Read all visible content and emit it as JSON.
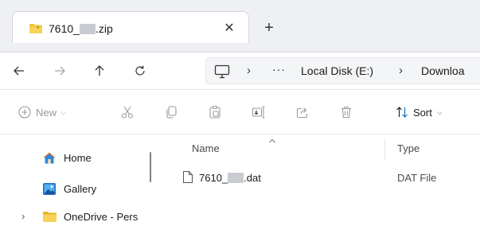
{
  "tab": {
    "title_prefix": "7610_",
    "title_suffix": ".zip",
    "close_glyph": "✕",
    "new_tab_glyph": "+",
    "icon": "folder-zip-icon"
  },
  "nav": {
    "back_icon": "arrow-left-icon",
    "forward_icon": "arrow-right-icon",
    "up_icon": "arrow-up-icon",
    "refresh_icon": "refresh-icon",
    "more_glyph": "···",
    "breadcrumb": [
      "Local Disk (E:)",
      "Downloa"
    ]
  },
  "toolbar": {
    "new_label": "New",
    "sort_label": "Sort"
  },
  "sidebar": {
    "items": [
      {
        "label": "Home",
        "icon": "home-icon"
      },
      {
        "label": "Gallery",
        "icon": "gallery-icon"
      },
      {
        "label": "OneDrive - Pers",
        "icon": "folder-icon"
      }
    ]
  },
  "table": {
    "columns": [
      "Name",
      "Type"
    ],
    "rows": [
      {
        "name_prefix": "7610_",
        "name_suffix": ".dat",
        "type": "DAT File"
      }
    ]
  },
  "colors": {
    "folder": "#f2c230",
    "accent": "#0067c0",
    "disabled": "#9a9a9a"
  }
}
